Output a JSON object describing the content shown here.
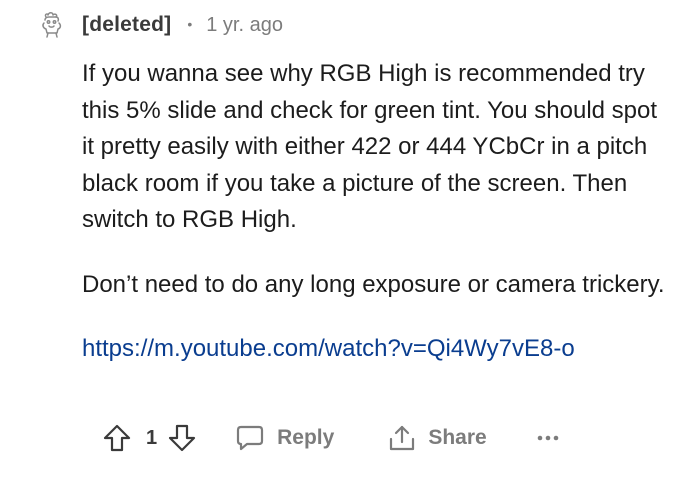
{
  "comment": {
    "author": "[deleted]",
    "separator": "•",
    "age": "1 yr. ago",
    "paragraphs": [
      "If you wanna see why RGB High is recommended try this 5% slide and check for green tint. You should spot it pretty easily with either 422 or 444 YCbCr in a pitch black room if you take a picture of the screen. Then switch to RGB High.",
      "Don’t need to do any long exposure or camera trickery."
    ],
    "link": "https://m.youtube.com/watch?v=Qi4Wy7vE8-o",
    "score": "1"
  },
  "actions": {
    "reply_label": "Reply",
    "share_label": "Share",
    "more_label": "···"
  },
  "icons": {
    "avatar": "deleted-user-icon",
    "upvote": "arrow-up-icon",
    "downvote": "arrow-down-icon",
    "reply": "speech-bubble-icon",
    "share": "share-icon",
    "more": "ellipsis-icon"
  },
  "colors": {
    "text": "#1c1c1c",
    "meta": "#7c7c7c",
    "link": "#0a3d8f"
  }
}
